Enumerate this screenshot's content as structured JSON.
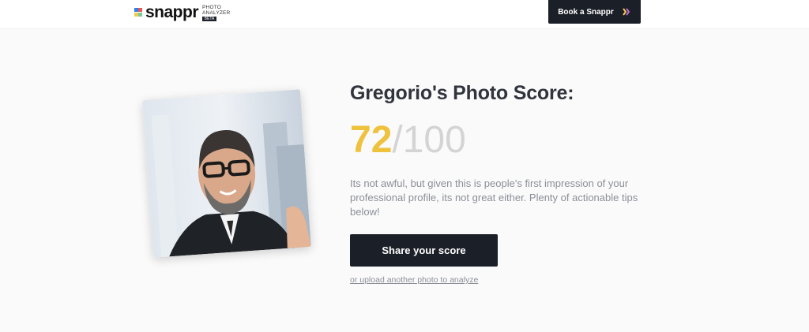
{
  "header": {
    "brand": "snappr",
    "brand_sub_line1": "PHOTO",
    "brand_sub_line2": "ANALYZER",
    "brand_badge": "BETA",
    "book_button": "Book a Snappr"
  },
  "result": {
    "title": "Gregorio's Photo Score:",
    "score": "72",
    "score_separator": "/",
    "score_max": "100",
    "description": "Its not awful, but given this is people's first impression of your professional profile, its not great either. Plenty of actionable tips below!",
    "share_button": "Share your score",
    "upload_link": "or upload another photo to analyze"
  },
  "colors": {
    "score": "#efc23d",
    "button_bg": "#1b1f27",
    "muted_text": "#8b8f98"
  }
}
